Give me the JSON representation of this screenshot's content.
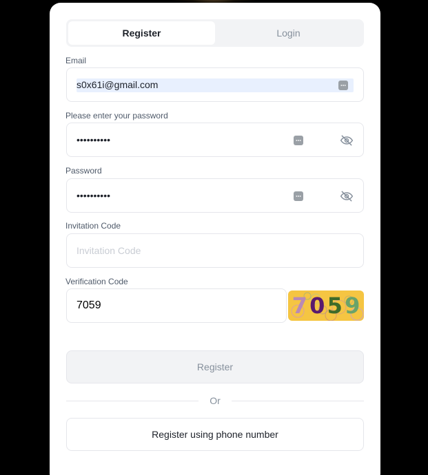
{
  "tabs": [
    {
      "label": "Register",
      "active": true
    },
    {
      "label": "Login",
      "active": false
    }
  ],
  "email": {
    "label": "Email",
    "value": "s0x61i@gmail.com"
  },
  "password_new": {
    "label": "Please enter your password",
    "value": "••••••••••"
  },
  "password_confirm": {
    "label": "Password",
    "value": "••••••••••"
  },
  "invitation": {
    "label": "Invitation Code",
    "placeholder": "Invitation Code",
    "value": ""
  },
  "verification": {
    "label": "Verification Code",
    "value": "7059"
  },
  "captcha": {
    "digits": [
      "7",
      "0",
      "5",
      "9"
    ],
    "digit_colors": [
      "#b98ab5",
      "#5a1a6e",
      "#3f6b2a",
      "#6aa36a"
    ],
    "background": "#f5c542"
  },
  "actions": {
    "register_label": "Register",
    "or_label": "Or",
    "phone_label": "Register using phone number"
  }
}
